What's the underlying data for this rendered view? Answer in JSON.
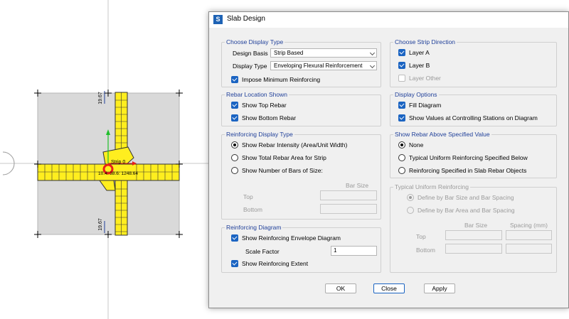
{
  "drawing": {
    "dimension_top": "19.67",
    "dimension_bottom": "19.67",
    "strip_label": "Strip 0",
    "value_label": "10.4: 38.6: 1248.64",
    "colors": {
      "strip_fill": "#ffee1f",
      "slab": "#d9d9d9",
      "marker": "#e8201a",
      "axis_green": "#1fbf2a"
    }
  },
  "dialog": {
    "title": "Slab Design",
    "choose_display_type": {
      "legend": "Choose Display Type",
      "design_basis_label": "Design Basis",
      "design_basis_value": "Strip Based",
      "display_type_label": "Display Type",
      "display_type_value": "Enveloping Flexural Reinforcement",
      "impose_min_label": "Impose Minimum Reinforcing",
      "impose_min_checked": true
    },
    "rebar_location": {
      "legend": "Rebar Location Shown",
      "top_label": "Show Top Rebar",
      "bottom_label": "Show Bottom Rebar"
    },
    "reinforcing_display_type": {
      "legend": "Reinforcing Display Type",
      "options": [
        "Show Rebar Intensity (Area/Unit Width)",
        "Show Total Rebar Area for Strip",
        "Show Number of Bars of Size:"
      ],
      "bar_size_header": "Bar Size",
      "top_label": "Top",
      "bottom_label": "Bottom"
    },
    "reinforcing_diagram": {
      "legend": "Reinforcing Diagram",
      "envelope_label": "Show Reinforcing Envelope Diagram",
      "scale_factor_label": "Scale Factor",
      "scale_factor_value": "1",
      "extent_label": "Show Reinforcing Extent"
    },
    "strip_direction": {
      "legend": "Choose Strip Direction",
      "layer_a": "Layer A",
      "layer_b": "Layer B",
      "layer_other": "Layer Other"
    },
    "display_options": {
      "legend": "Display Options",
      "fill_label": "Fill Diagram",
      "values_label": "Show Values at Controlling Stations on Diagram"
    },
    "rebar_above_value": {
      "legend": "Show Rebar Above Specified Value",
      "options": [
        "None",
        "Typical Uniform Reinforcing Specified Below",
        "Reinforcing Specified in Slab Rebar Objects"
      ]
    },
    "typical_uniform": {
      "legend": "Typical Uniform Reinforcing",
      "options": [
        "Define by Bar Size and Bar Spacing",
        "Define by Bar Area and Bar Spacing"
      ],
      "bar_size_header": "Bar Size",
      "spacing_header": "Spacing  (mm)",
      "top_label": "Top",
      "bottom_label": "Bottom"
    },
    "buttons": {
      "ok": "OK",
      "close": "Close",
      "apply": "Apply"
    }
  }
}
